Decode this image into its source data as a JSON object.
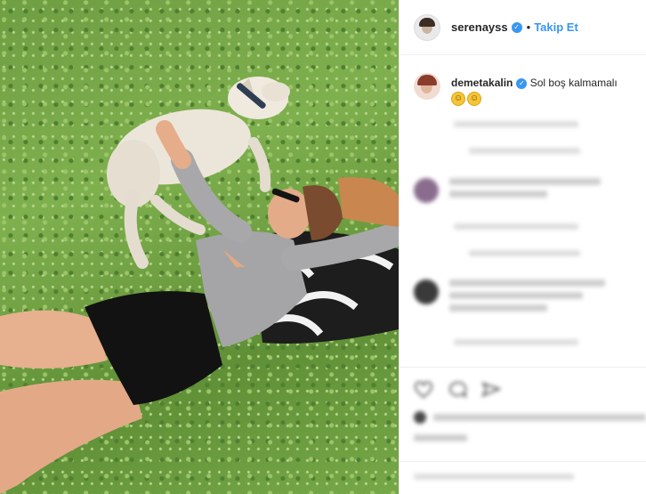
{
  "post": {
    "username": "serenayss",
    "follow_label": "Takip Et",
    "separator": "•"
  },
  "caption": {
    "username": "demetakalin",
    "text": "Sol boş kalmamalı",
    "emojis": [
      "smile-emoji",
      "laugh-emoji"
    ]
  },
  "colors": {
    "link": "#3897f0",
    "text": "#262626",
    "verified_badge": "#3897f0"
  },
  "icons": [
    "verified-badge-icon",
    "heart-icon",
    "comment-icon",
    "share-icon"
  ]
}
